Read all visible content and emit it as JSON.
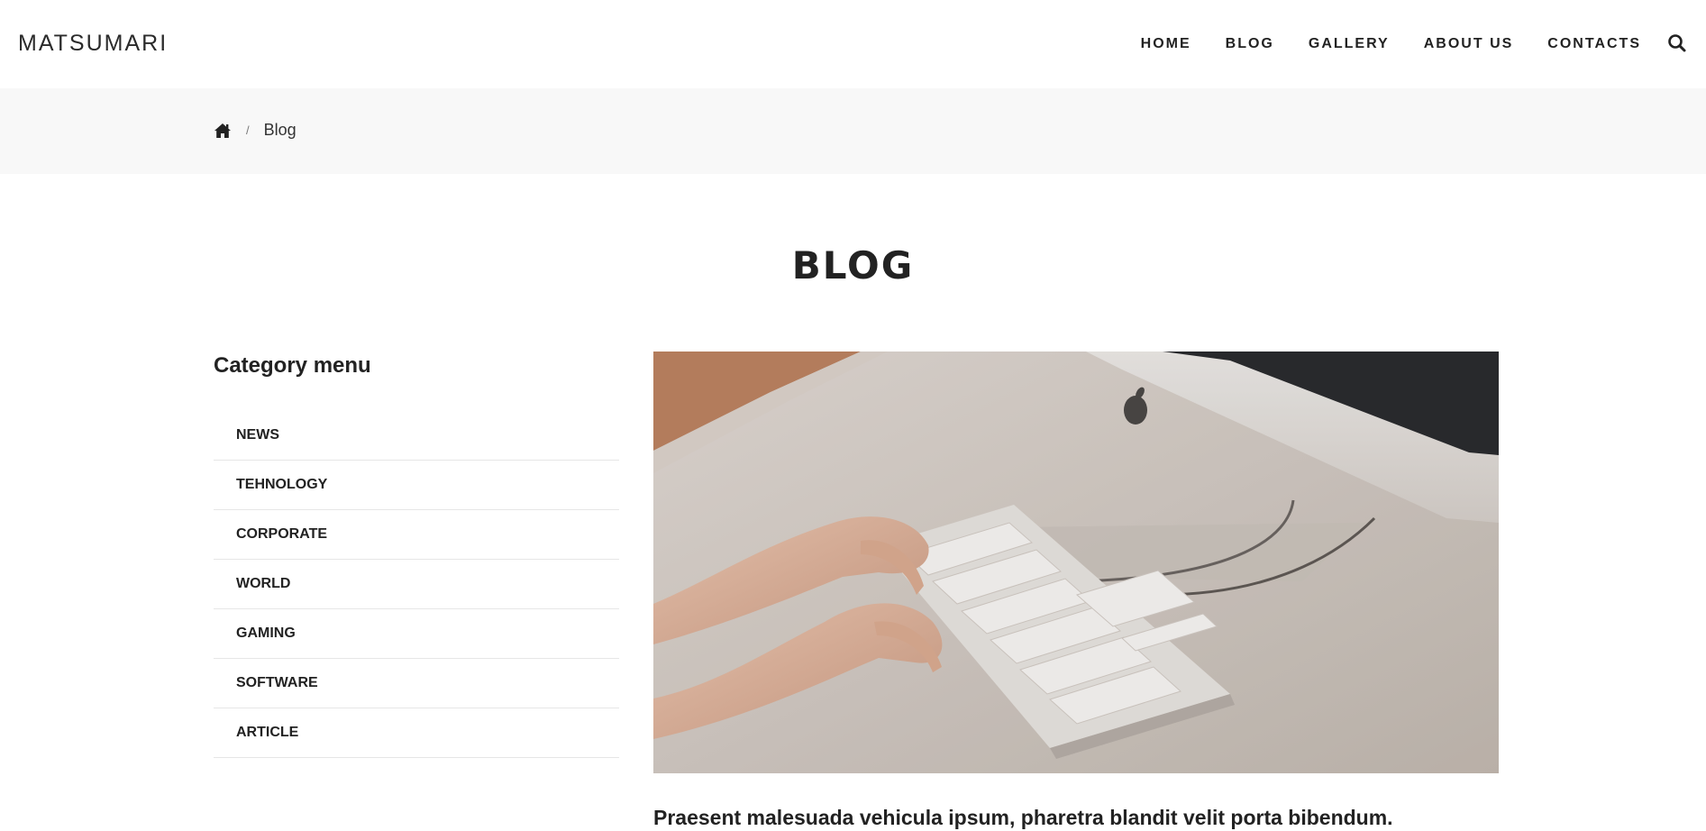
{
  "header": {
    "logo": "MATSUMARI",
    "nav": [
      {
        "label": "HOME"
      },
      {
        "label": "BLOG"
      },
      {
        "label": "GALLERY"
      },
      {
        "label": "ABOUT US"
      },
      {
        "label": "CONTACTS"
      }
    ],
    "search_icon": "search-icon"
  },
  "breadcrumb": {
    "home_icon": "home-icon",
    "separator": "/",
    "current": "Blog"
  },
  "page": {
    "title": "BLOG"
  },
  "sidebar": {
    "title": "Category menu",
    "categories": [
      {
        "label": "NEWS"
      },
      {
        "label": "TEHNOLOGY"
      },
      {
        "label": "CORPORATE"
      },
      {
        "label": "WORLD"
      },
      {
        "label": "GAMING"
      },
      {
        "label": "SOFTWARE"
      },
      {
        "label": "ARTICLE"
      }
    ]
  },
  "post": {
    "image_subject": "hands-typing-on-keyboard-photo",
    "title": "Praesent malesuada vehicula ipsum, pharetra blandit velit porta bibendum."
  },
  "colors": {
    "text": "#222222",
    "band": "#f8f8f8",
    "divider": "#e6e6e6"
  }
}
